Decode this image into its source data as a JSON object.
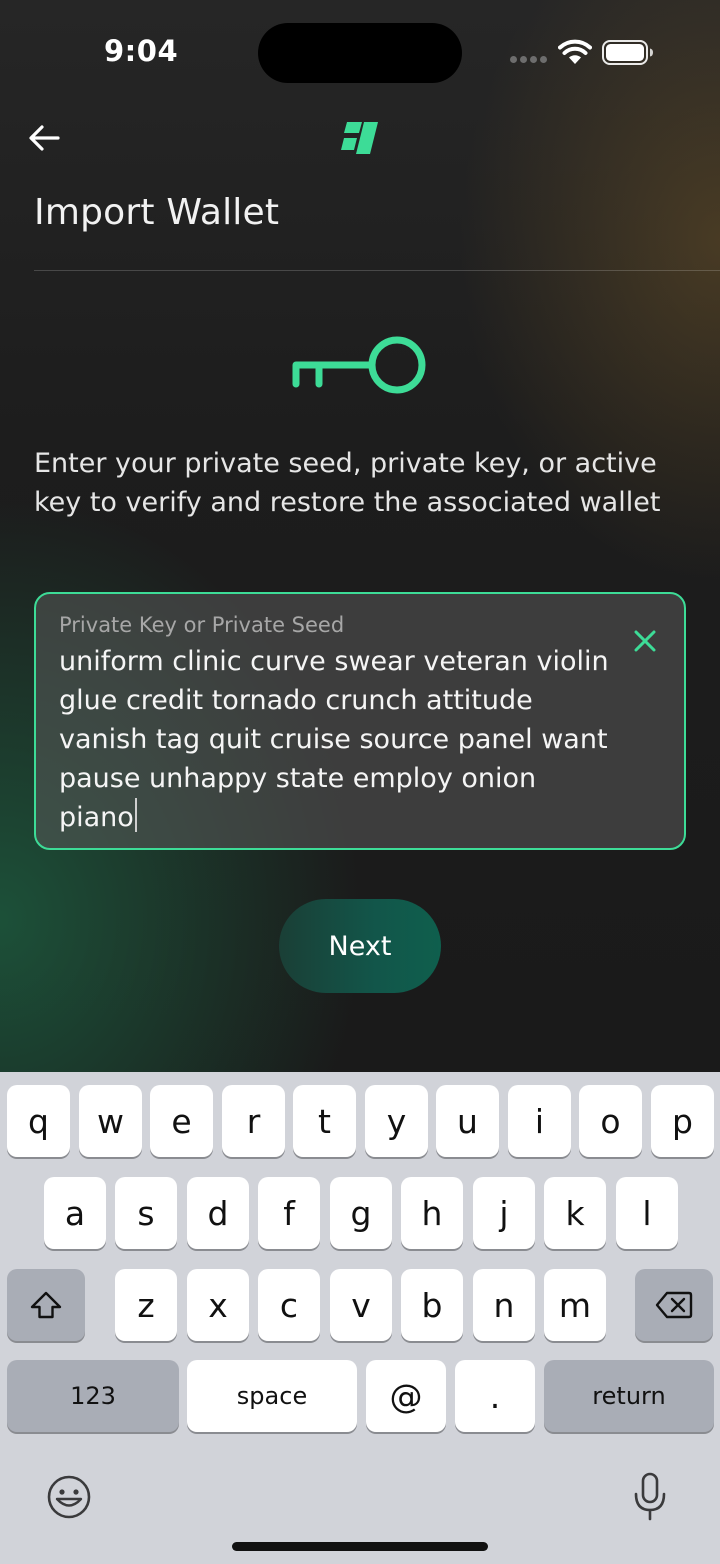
{
  "status": {
    "time": "9:04"
  },
  "header": {
    "title": "Import Wallet"
  },
  "main": {
    "instructions": "Enter your private seed, private key, or active key to verify and restore the associated wallet",
    "input": {
      "label": "Private Key or Private Seed",
      "value": "uniform clinic curve swear veteran violin glue credit tornado crunch attitude vanish tag quit cruise source panel want pause unhappy state employ onion piano"
    },
    "next_label": "Next"
  },
  "colors": {
    "accent": "#3ddc97",
    "button": "#12564a"
  },
  "keyboard": {
    "row1": [
      "q",
      "w",
      "e",
      "r",
      "t",
      "y",
      "u",
      "i",
      "o",
      "p"
    ],
    "row2": [
      "a",
      "s",
      "d",
      "f",
      "g",
      "h",
      "j",
      "k",
      "l"
    ],
    "row3": [
      "z",
      "x",
      "c",
      "v",
      "b",
      "n",
      "m"
    ],
    "numbers_label": "123",
    "space_label": "space",
    "at_label": "@",
    "dot_label": ".",
    "return_label": "return"
  }
}
